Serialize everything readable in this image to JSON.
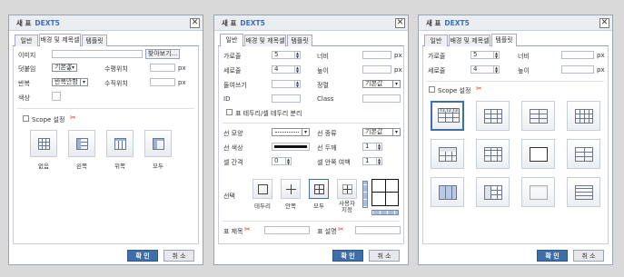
{
  "dialogs": [
    {
      "title": "새 표",
      "brand": "DEXT5",
      "close": "✕",
      "tabs": [
        "일반",
        "배경 및 제목셀",
        "템플릿"
      ],
      "active_tab": 1
    },
    {
      "title": "새 표",
      "brand": "DEXT5",
      "close": "✕",
      "tabs": [
        "일반",
        "배경 및 제목셀",
        "템플릿"
      ],
      "active_tab": 0
    },
    {
      "title": "새 표",
      "brand": "DEXT5",
      "close": "✕",
      "tabs": [
        "일반",
        "배경 및 제목셀",
        "템플릿"
      ],
      "active_tab": 2
    }
  ],
  "bg": {
    "image_label": "이미지",
    "browse": "찾아보기...",
    "attach_label": "덧붙임",
    "attach_value": "기본값",
    "hpos_label": "수평위치",
    "hpos_unit": "px",
    "repeat_label": "반복",
    "repeat_value": "반복안함",
    "vpos_label": "수직위치",
    "vpos_unit": "px",
    "color_label": "색상",
    "scope_label": "Scope 설정",
    "options": [
      "없음",
      "왼쪽",
      "위쪽",
      "모두"
    ]
  },
  "general": {
    "cols_label": "가로줄",
    "cols_value": "5",
    "width_label": "너비",
    "width_unit": "px",
    "rows_label": "세로줄",
    "rows_value": "4",
    "height_label": "높이",
    "height_unit": "px",
    "indent_label": "들여쓰기",
    "align_label": "정렬",
    "align_value": "기본값",
    "id_label": "ID",
    "class_label": "Class",
    "sep_label": "표 테두리/셀 테두리 분리",
    "linestyle_label": "선 모양",
    "linetype_label": "선 종류",
    "linetype_value": "기본값",
    "linecolor_label": "선 색상",
    "linewidth_label": "선 두께",
    "linewidth_value": "1",
    "spacing_label": "셀 간격",
    "spacing_value": "0",
    "padding_label": "셀 안쪽 여백",
    "padding_value": "1",
    "select_label": "선택",
    "border_opts": [
      "테두리",
      "안쪽",
      "모두",
      "사용자\n지정"
    ],
    "caption_label": "표 제목",
    "summary_label": "표 설명"
  },
  "template": {
    "cols_label": "가로줄",
    "cols_value": "5",
    "width_label": "너비",
    "width_unit": "px",
    "rows_label": "세로줄",
    "rows_value": "4",
    "height_label": "높이",
    "height_unit": "px",
    "scope_label": "Scope 설정",
    "first_tile_text": "T1 T2 T3"
  },
  "buttons": {
    "ok": "확 인",
    "cancel": "취 소"
  }
}
